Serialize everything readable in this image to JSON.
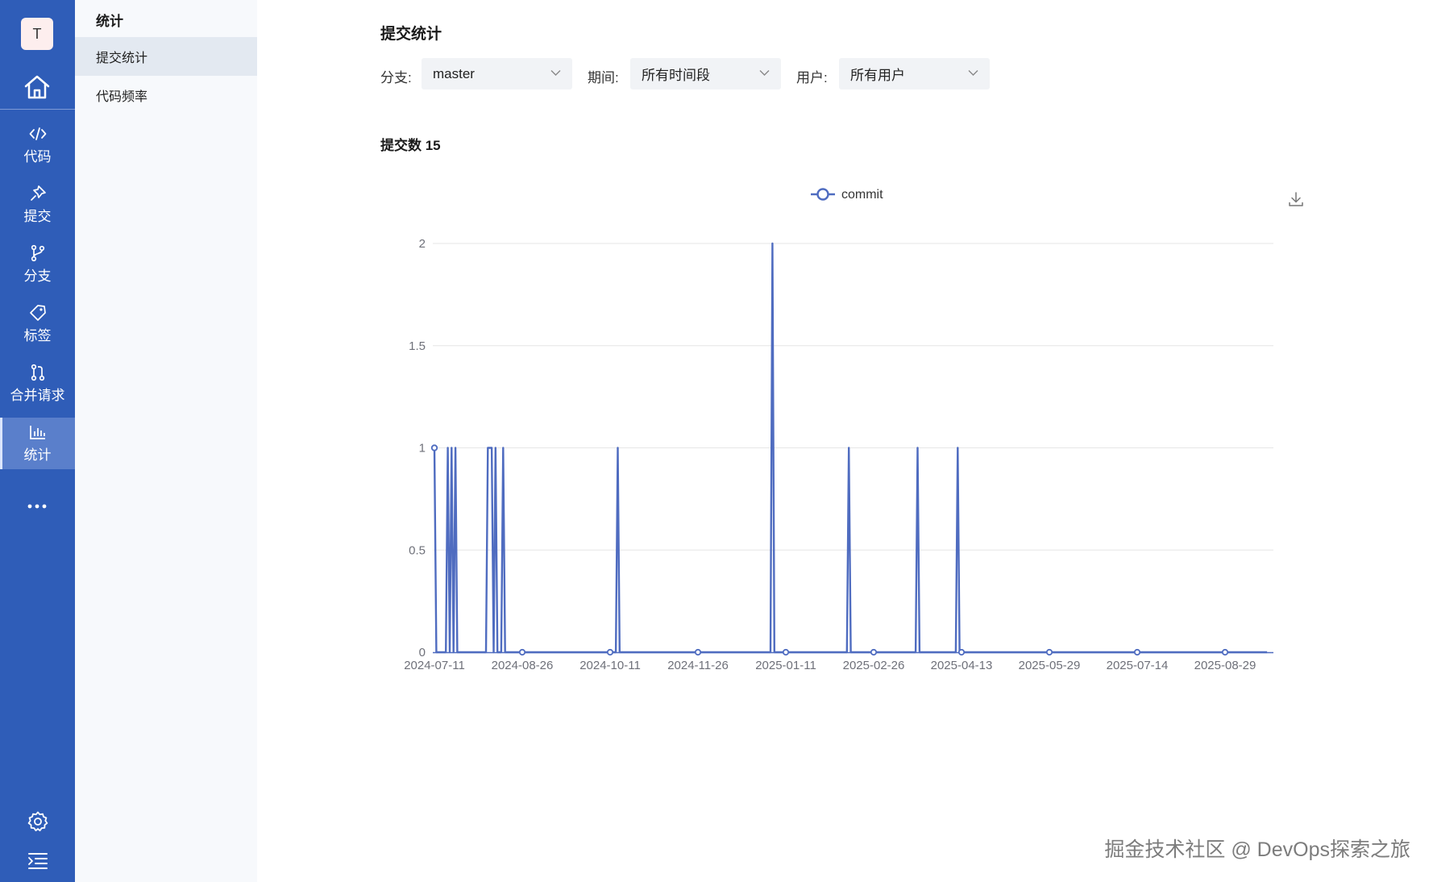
{
  "rail": {
    "avatar_letter": "T",
    "items": [
      {
        "label": "代码",
        "icon": "code-icon"
      },
      {
        "label": "提交",
        "icon": "pin-icon"
      },
      {
        "label": "分支",
        "icon": "branch-icon"
      },
      {
        "label": "标签",
        "icon": "tag-icon"
      },
      {
        "label": "合并请求",
        "icon": "merge-request-icon"
      },
      {
        "label": "统计",
        "icon": "bar-chart-icon",
        "active": true
      }
    ]
  },
  "submenu": {
    "title": "统计",
    "items": [
      {
        "label": "提交统计",
        "active": true
      },
      {
        "label": "代码频率",
        "active": false
      }
    ]
  },
  "main": {
    "title": "提交统计",
    "filters": {
      "branch": {
        "label": "分支:",
        "value": "master"
      },
      "period": {
        "label": "期间:",
        "value": "所有时间段"
      },
      "user": {
        "label": "用户:",
        "value": "所有用户"
      }
    },
    "commit_count": "提交数 15"
  },
  "colors": {
    "rail_bg": "#2f5db8",
    "rail_active": "#5a7fcb",
    "series_line": "#4f6cc0"
  },
  "chart_data": {
    "type": "line",
    "title": "",
    "xlabel": "",
    "ylabel": "",
    "ylim": [
      0,
      2
    ],
    "yticks": [
      "0",
      "0.5",
      "1",
      "1.5",
      "2"
    ],
    "x_tick_labels": [
      "2024-07-11",
      "2024-08-26",
      "2024-10-11",
      "2024-11-26",
      "2025-01-11",
      "2025-02-26",
      "2025-04-13",
      "2025-05-29",
      "2025-07-14",
      "2025-08-29"
    ],
    "x_range": [
      "2024-07-11",
      "2025-09-20"
    ],
    "legend": {
      "position": "top-center",
      "entries": [
        "commit"
      ]
    },
    "grid": true,
    "series": [
      {
        "name": "commit",
        "points": [
          [
            "2024-07-11",
            1
          ],
          [
            "2024-07-12",
            0
          ],
          [
            "2024-07-17",
            0
          ],
          [
            "2024-07-18",
            1
          ],
          [
            "2024-07-19",
            0
          ],
          [
            "2024-07-20",
            1
          ],
          [
            "2024-07-21",
            0
          ],
          [
            "2024-07-22",
            1
          ],
          [
            "2024-07-23",
            0
          ],
          [
            "2024-08-07",
            0
          ],
          [
            "2024-08-08",
            1
          ],
          [
            "2024-08-10",
            1
          ],
          [
            "2024-08-11",
            0
          ],
          [
            "2024-08-12",
            1
          ],
          [
            "2024-08-13",
            0
          ],
          [
            "2024-08-15",
            0
          ],
          [
            "2024-08-16",
            1
          ],
          [
            "2024-08-17",
            0
          ],
          [
            "2024-10-14",
            0
          ],
          [
            "2024-10-15",
            1
          ],
          [
            "2024-10-16",
            0
          ],
          [
            "2025-01-03",
            0
          ],
          [
            "2025-01-04",
            2
          ],
          [
            "2025-01-05",
            0
          ],
          [
            "2025-02-12",
            0
          ],
          [
            "2025-02-13",
            1
          ],
          [
            "2025-02-14",
            0
          ],
          [
            "2025-03-20",
            0
          ],
          [
            "2025-03-21",
            1
          ],
          [
            "2025-03-22",
            0
          ],
          [
            "2025-04-10",
            0
          ],
          [
            "2025-04-11",
            1
          ],
          [
            "2025-04-12",
            0
          ],
          [
            "2025-09-20",
            0
          ]
        ],
        "markers": [
          "2024-07-11",
          "2024-08-26",
          "2024-10-11",
          "2024-11-26",
          "2025-01-11",
          "2025-02-26",
          "2025-04-13",
          "2025-05-29",
          "2025-07-14",
          "2025-08-29"
        ]
      }
    ]
  },
  "watermark": "掘金技术社区 @ DevOps探索之旅"
}
